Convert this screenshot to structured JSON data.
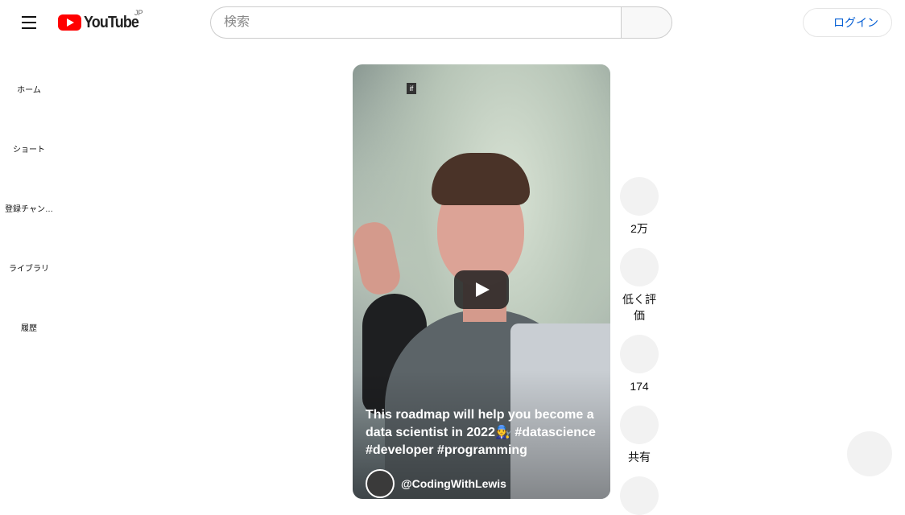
{
  "header": {
    "logo_text": "YouTube",
    "region": "JP",
    "search_placeholder": "検索",
    "login_label": "ログイン"
  },
  "sidebar": {
    "items": [
      {
        "label": "ホーム"
      },
      {
        "label": "ショート"
      },
      {
        "label": "登録チャン…"
      },
      {
        "label": "ライブラリ"
      },
      {
        "label": "履歴"
      }
    ]
  },
  "video": {
    "overlay_badge": "if",
    "caption_line1": "This roadmap will help you become a data scientist in 2022🧑‍🔧 ",
    "caption_tags": "#datascience #developer #programming",
    "channel_name": "@CodingWithLewis"
  },
  "actions": {
    "like_count": "2万",
    "dislike_label": "低く評価",
    "comment_count": "174",
    "share_label": "共有"
  }
}
